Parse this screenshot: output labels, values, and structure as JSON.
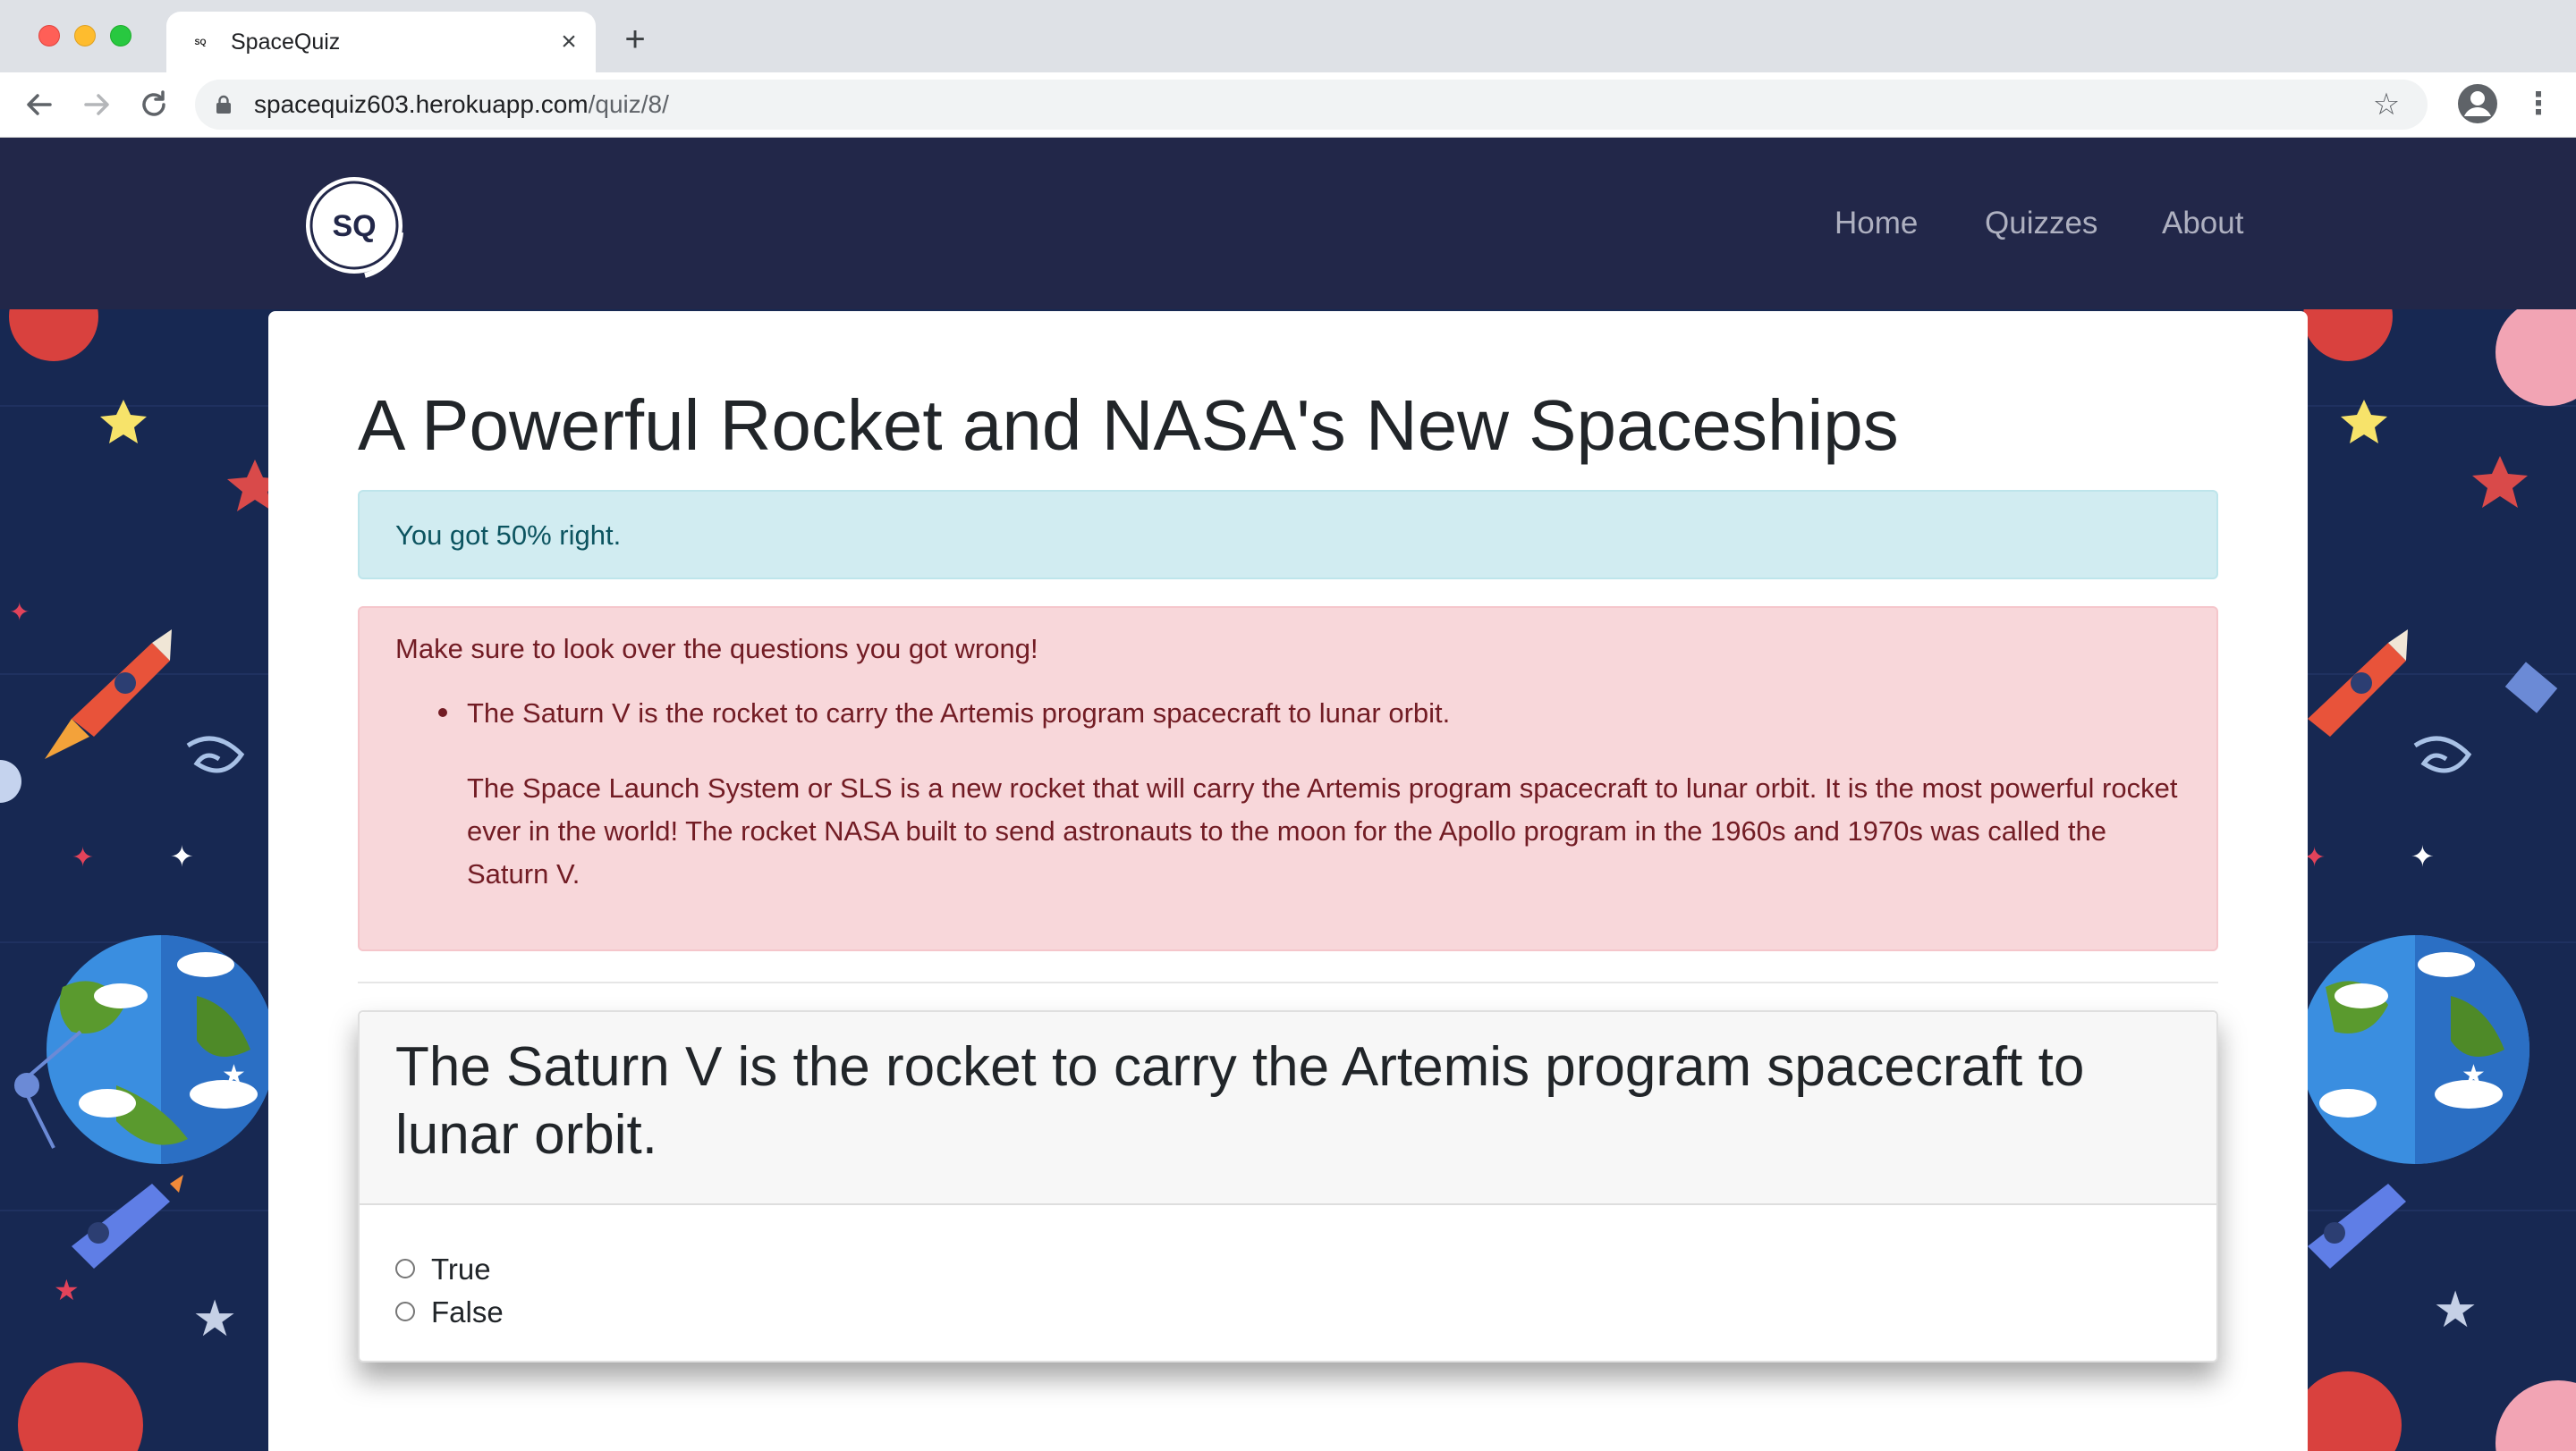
{
  "browser": {
    "tab_title": "SpaceQuiz",
    "tab_favicon": "SQ",
    "url_host": "spacequiz603.herokuapp.com",
    "url_path": "/quiz/8/",
    "new_tab": "+",
    "close_tab": "×"
  },
  "site": {
    "logo_text": "SQ",
    "nav": [
      {
        "label": "Home"
      },
      {
        "label": "Quizzes"
      },
      {
        "label": "About"
      }
    ]
  },
  "quiz": {
    "title": "A Powerful Rocket and NASA's New Spaceships",
    "score_text": "You got 50% right.",
    "wrong": {
      "intro": "Make sure to look over the questions you got wrong!",
      "items": [
        {
          "question": "The Saturn V is the rocket to carry the Artemis program spacecraft to lunar orbit.",
          "explanation": "The Space Launch System or SLS is a new rocket that will carry the Artemis program spacecraft to lunar orbit. It is the most powerful rocket ever in the world! The rocket NASA built to send astronauts to the moon for the Apollo program in the 1960s and 1970s was called the Saturn V."
        }
      ]
    },
    "question_card": {
      "question": "The Saturn V is the rocket to carry the Artemis program spacecraft to lunar orbit.",
      "options": [
        {
          "label": "True"
        },
        {
          "label": "False"
        }
      ]
    }
  },
  "colors": {
    "navbar_bg": "#222749",
    "page_bg": "#172852",
    "alert_info_bg": "#d1ecf1",
    "alert_danger_bg": "#f8d7da"
  }
}
